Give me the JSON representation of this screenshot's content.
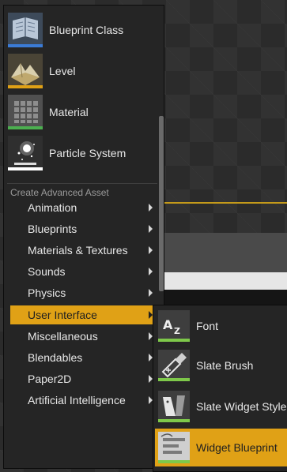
{
  "colors": {
    "accent": "#e0a116",
    "blueprint_strip": "#3b7bd6",
    "level_strip": "#e0a116",
    "material_strip": "#4caf50",
    "particle_strip": "#ffffff",
    "ui_strip": "#7ec84a"
  },
  "basic_assets": [
    {
      "label": "Blueprint Class",
      "icon": "blueprint-class-icon"
    },
    {
      "label": "Level",
      "icon": "level-icon"
    },
    {
      "label": "Material",
      "icon": "material-icon"
    },
    {
      "label": "Particle System",
      "icon": "particle-system-icon"
    }
  ],
  "advanced": {
    "header": "Create Advanced Asset",
    "items": [
      {
        "label": "Animation"
      },
      {
        "label": "Blueprints"
      },
      {
        "label": "Materials & Textures"
      },
      {
        "label": "Sounds"
      },
      {
        "label": "Physics"
      },
      {
        "label": "User Interface",
        "active": true
      },
      {
        "label": "Miscellaneous"
      },
      {
        "label": "Blendables"
      },
      {
        "label": "Paper2D"
      },
      {
        "label": "Artificial Intelligence"
      }
    ]
  },
  "ui_submenu": {
    "items": [
      {
        "label": "Font",
        "icon": "font-icon"
      },
      {
        "label": "Slate Brush",
        "icon": "slate-brush-icon"
      },
      {
        "label": "Slate Widget Style",
        "icon": "slate-widget-style-icon"
      },
      {
        "label": "Widget Blueprint",
        "icon": "widget-blueprint-icon",
        "active": true
      }
    ]
  }
}
